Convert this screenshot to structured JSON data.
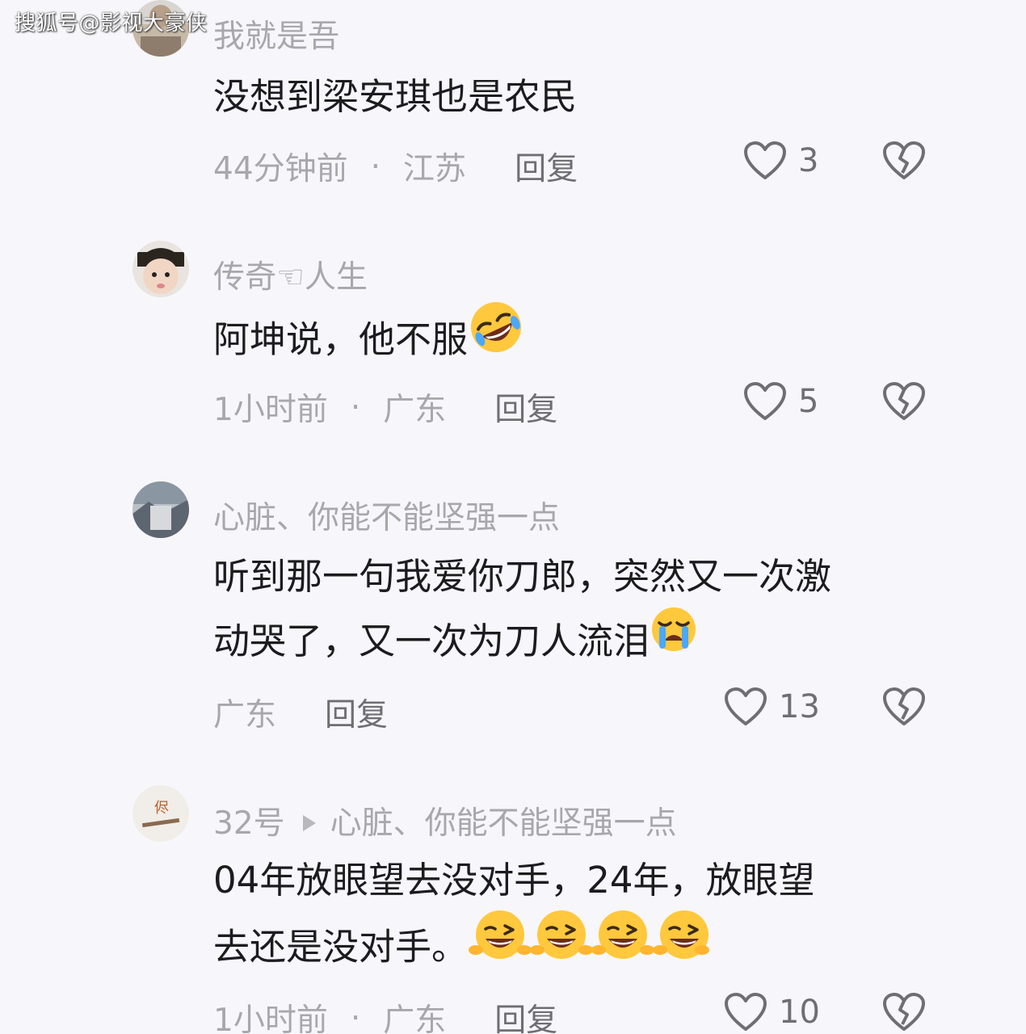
{
  "watermark": "搜狐号@影视大豪侠",
  "comments": [
    {
      "username": "我就是吾",
      "text": "没想到梁安琪也是农民",
      "time": "44分钟前",
      "separator": "·",
      "location": "江苏",
      "reply_label": "回复",
      "likes": "3"
    },
    {
      "username": "传奇☜人生",
      "text": "阿坤说，他不服",
      "time": "1小时前",
      "separator": "·",
      "location": "广东",
      "reply_label": "回复",
      "likes": "5"
    },
    {
      "username": "心脏、你能不能坚强一点",
      "text_line1": "听到那一句我爱你刀郎，突然又一次激",
      "text_line2": "动哭了，又一次为刀人流泪",
      "location": "广东",
      "reply_label": "回复",
      "likes": "13"
    },
    {
      "username": "32号",
      "reply_to": "心脏、你能不能坚强一点",
      "text_line1": "04年放眼望去没对手，24年，放眼望",
      "text_line2": "去还是没对手。",
      "time": "1小时前",
      "separator": "·",
      "location": "广东",
      "reply_label": "回复",
      "likes": "10"
    }
  ],
  "icons": {
    "like": "heart-outline-icon",
    "dislike": "broken-heart-icon",
    "emoji_laugh_cry": "rolling-laughing-emoji",
    "emoji_cry": "loudly-crying-emoji",
    "emoji_wink": "squinting-tongue-emoji"
  },
  "colors": {
    "background": "#f7f7fb",
    "username": "#a7a7ad",
    "body_text": "#1c1c1e",
    "meta": "#a7a7ad",
    "reply": "#6e6e74",
    "icon": "#6e6e74",
    "emoji_yellow": "#ffc83d"
  }
}
